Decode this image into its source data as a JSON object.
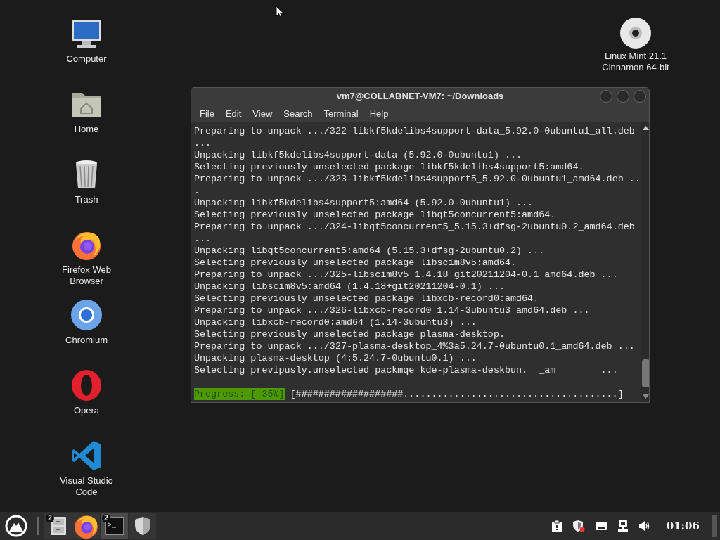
{
  "desktop_icons": [
    {
      "kind": "computer",
      "label": "Computer"
    },
    {
      "kind": "home",
      "label": "Home"
    },
    {
      "kind": "trash",
      "label": "Trash"
    },
    {
      "kind": "firefox",
      "label": "Firefox Web Browser"
    },
    {
      "kind": "chromium",
      "label": "Chromium"
    },
    {
      "kind": "opera",
      "label": "Opera"
    },
    {
      "kind": "vscode",
      "label": "Visual Studio Code"
    }
  ],
  "desktop_right_icon": {
    "kind": "disc",
    "label": "Linux Mint 21.1 Cinnamon 64-bit"
  },
  "terminal": {
    "title": "vm7@COLLABNET-VM7: ~/Downloads",
    "menu": [
      "File",
      "Edit",
      "View",
      "Search",
      "Terminal",
      "Help"
    ],
    "lines": [
      "Preparing to unpack .../322-libkf5kdelibs4support-data_5.92.0-0ubuntu1_all.deb",
      "...",
      "Unpacking libkf5kdelibs4support-data (5.92.0-0ubuntu1) ...",
      "Selecting previously unselected package libkf5kdelibs4support5:amd64.",
      "Preparing to unpack .../323-libkf5kdelibs4support5_5.92.0-0ubuntu1_amd64.deb ..",
      ".",
      "Unpacking libkf5kdelibs4support5:amd64 (5.92.0-0ubuntu1) ...",
      "Selecting previously unselected package libqt5concurrent5:amd64.",
      "Preparing to unpack .../324-libqt5concurrent5_5.15.3+dfsg-2ubuntu0.2_amd64.deb",
      "...",
      "Unpacking libqt5concurrent5:amd64 (5.15.3+dfsg-2ubuntu0.2) ...",
      "Selecting previously unselected package libscim8v5:amd64.",
      "Preparing to unpack .../325-libscim8v5_1.4.18+git20211204-0.1_amd64.deb ...",
      "Unpacking libscim8v5:amd64 (1.4.18+git20211204-0.1) ...",
      "Selecting previously unselected package libxcb-record0:amd64.",
      "Preparing to unpack .../326-libxcb-record0_1.14-3ubuntu3_amd64.deb ...",
      "Unpacking libxcb-record0:amd64 (1.14-3ubuntu3) ...",
      "Selecting previously unselected package plasma-desktop.",
      "Preparing to unpack .../327-plasma-desktop_4%3a5.24.7-0ubuntu0.1_amd64.deb ...",
      "Unpacking plasma-desktop (4:5.24.7-0ubuntu0.1) ...",
      "Selecting previpusly.unselected packmqe kde-plasma-deskbun.  _am        ..."
    ],
    "progress_label": "Progress: [ 35%]",
    "progress_bar": "[###################......................................]"
  },
  "taskbar": {
    "items": [
      {
        "kind": "files",
        "badge": "2",
        "selected": false
      },
      {
        "kind": "firefox",
        "selected": false
      },
      {
        "kind": "terminal",
        "badge": "2",
        "selected": true
      },
      {
        "kind": "shield",
        "selected": false
      }
    ],
    "tray": [
      {
        "kind": "clipboard"
      },
      {
        "kind": "shield-alert"
      },
      {
        "kind": "keyboard"
      },
      {
        "kind": "network"
      },
      {
        "kind": "volume"
      }
    ],
    "clock": "01:06"
  }
}
